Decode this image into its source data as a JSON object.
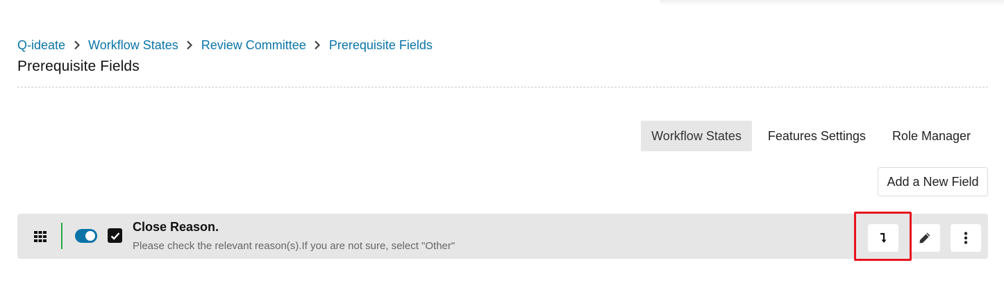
{
  "breadcrumb": {
    "items": [
      "Q-ideate",
      "Workflow States",
      "Review Committee",
      "Prerequisite Fields"
    ]
  },
  "page": {
    "title": "Prerequisite Fields"
  },
  "tabs": [
    {
      "label": "Workflow States",
      "active": true
    },
    {
      "label": "Features Settings",
      "active": false
    },
    {
      "label": "Role Manager",
      "active": false
    }
  ],
  "actions": {
    "add_field_label": "Add a New Field"
  },
  "field": {
    "title": "Close Reason.",
    "description": "Please check the relevant reason(s).If you are not sure, select \"Other\"",
    "enabled": true,
    "required": true
  },
  "icons": {
    "drag": "grid-drag-icon",
    "move": "arrow-down-right-angle-icon",
    "edit": "pencil-icon",
    "more": "vertical-ellipsis-icon"
  },
  "colors": {
    "link": "#0a74a8",
    "toggle_on": "#0a74a8",
    "separator": "#28a745",
    "highlight": "#e8141e",
    "row_bg": "#e6e6e6"
  }
}
